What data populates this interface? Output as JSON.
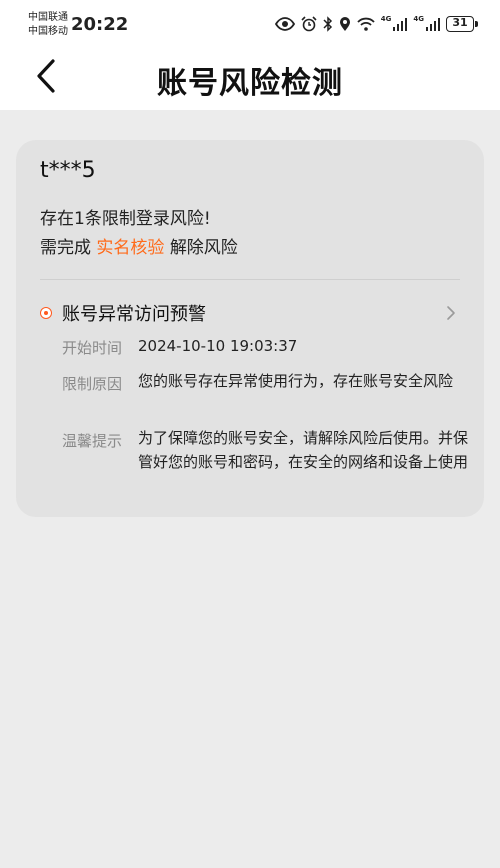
{
  "status_bar": {
    "carrier_1": "中国联通",
    "carrier_2": "中国移动",
    "time": "20:22",
    "signal_label": "4G",
    "battery": "31"
  },
  "header": {
    "title": "账号风险检测"
  },
  "card": {
    "account": "t***5",
    "risk_text": "存在1条限制登录风险!",
    "need_prefix": "需完成",
    "verify_link": "实名核验",
    "need_suffix": "解除风险",
    "alert": {
      "title": "账号异常访问预警",
      "start_label": "开始时间",
      "start_value": "2024-10-10 19:03:37",
      "reason_label": "限制原因",
      "reason_value": "您的账号存在异常使用行为，存在账号安全风险",
      "tip_label": "温馨提示",
      "tip_value": "为了保障您的账号安全，请解除风险后使用。并保管好您的账号和密码，在安全的网络和设备上使用"
    }
  },
  "colors": {
    "accent": "#ff6a1a",
    "background": "#ececec",
    "card": "#e2e2e2"
  }
}
